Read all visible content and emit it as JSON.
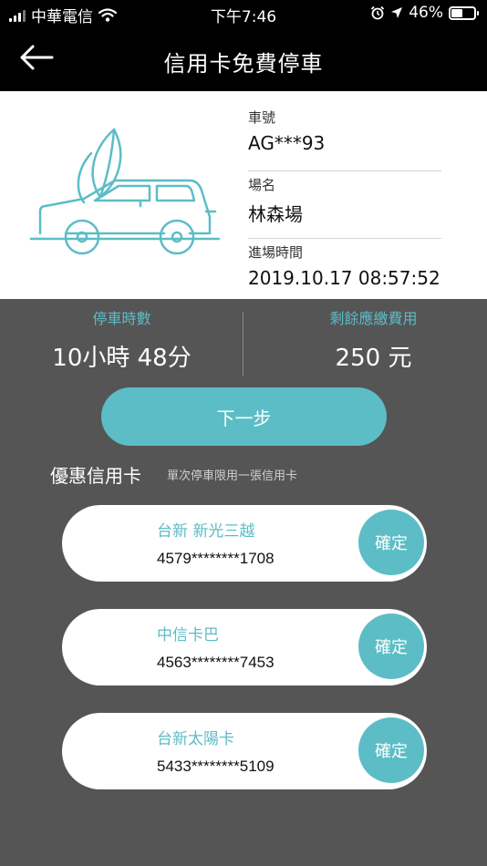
{
  "status_bar": {
    "carrier": "中華電信",
    "time": "下午7:46",
    "battery": "46%"
  },
  "header": {
    "title": "信用卡免費停車"
  },
  "info": {
    "plate_label": "車號",
    "plate_value": "AG***93",
    "lot_label": "場名",
    "lot_value": "林森場",
    "entry_label": "進場時間",
    "entry_value": "2019.10.17 08:57:52"
  },
  "summary": {
    "duration_label": "停車時數",
    "duration_value": "10小時 48分",
    "fee_label": "剩餘應繳費用",
    "fee_value": "250 元"
  },
  "next_button": "下一步",
  "section": {
    "title": "優惠信用卡",
    "note": "單次停車限用一張信用卡"
  },
  "cards": [
    {
      "name": "台新 新光三越",
      "number": "4579********1708",
      "button": "確定"
    },
    {
      "name": "中信卡巴",
      "number": "4563********7453",
      "button": "確定"
    },
    {
      "name": "台新太陽卡",
      "number": "5433********5109",
      "button": "確定"
    }
  ],
  "colors": {
    "accent": "#5cbdc6",
    "background": "#555555",
    "bar": "#000000"
  }
}
